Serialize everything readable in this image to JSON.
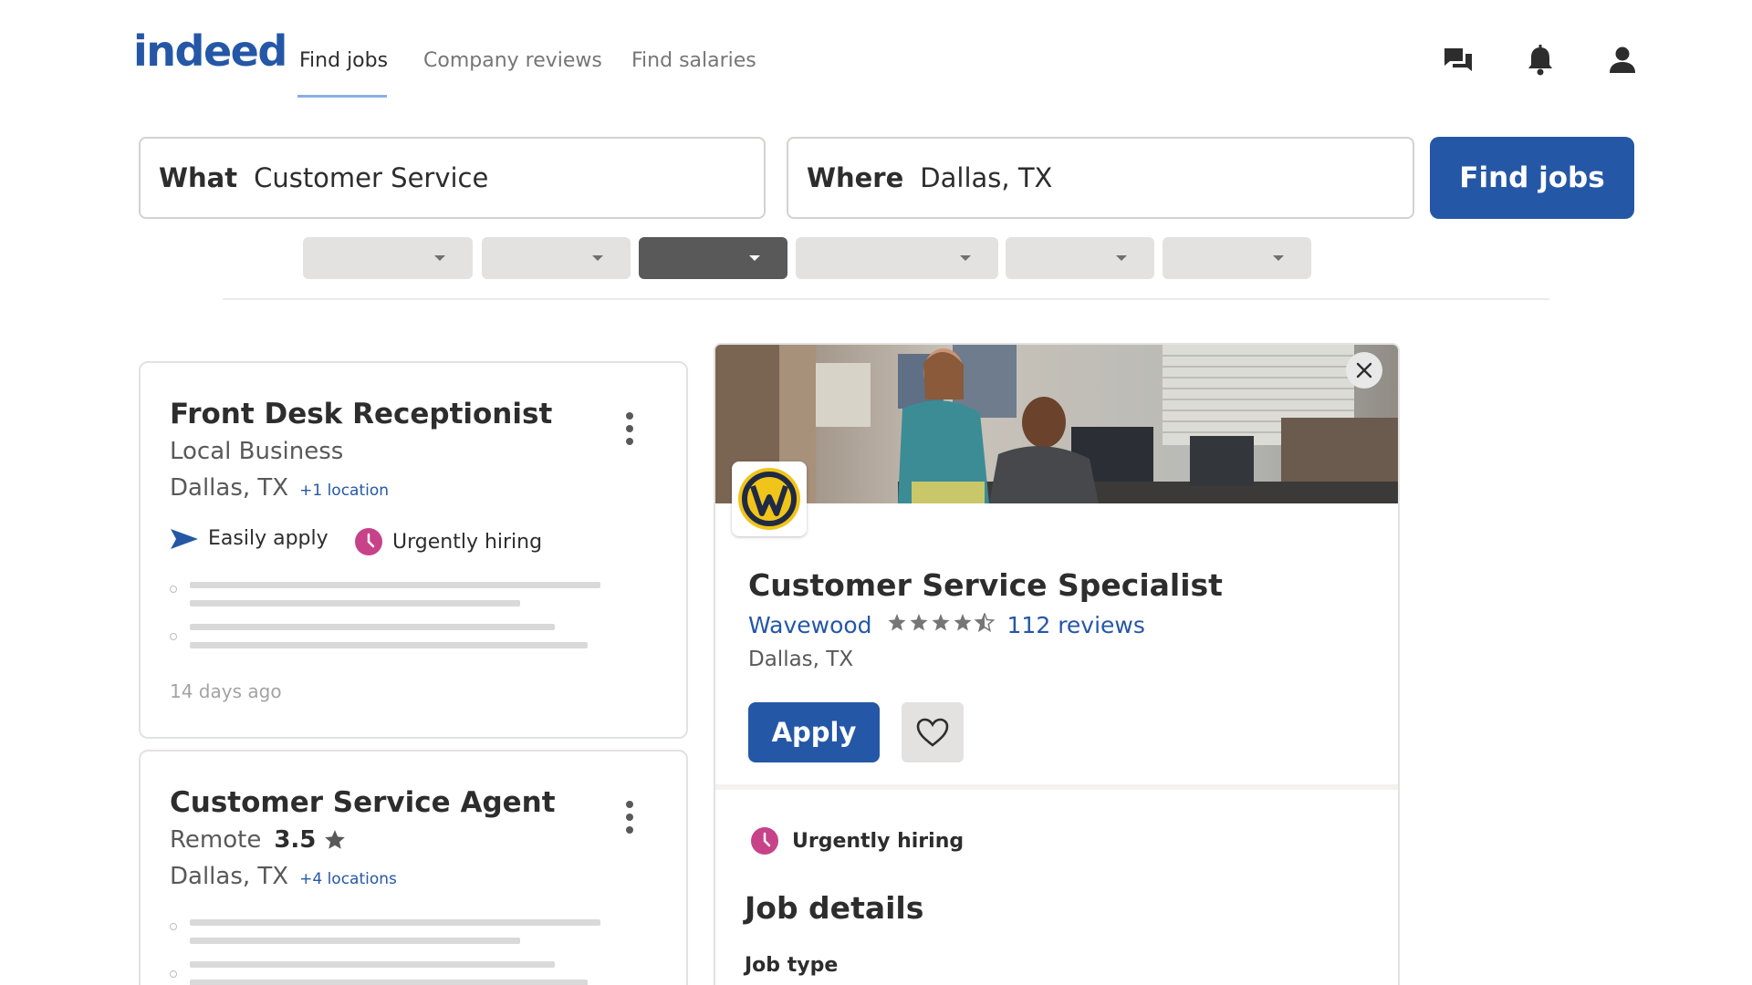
{
  "header": {
    "logo_text": "indeed",
    "nav": [
      {
        "label": "Find jobs",
        "active": true
      },
      {
        "label": "Company reviews",
        "active": false
      },
      {
        "label": "Find salaries",
        "active": false
      }
    ],
    "icons": [
      "messages-icon",
      "bell-icon",
      "profile-icon"
    ]
  },
  "search": {
    "what_label": "What",
    "what_value": "Customer Service",
    "where_label": "Where",
    "where_value": "Dallas, TX",
    "button_label": "Find jobs"
  },
  "jobs": [
    {
      "title": "Front Desk Receptionist",
      "company": "Local Business",
      "location": "Dallas, TX",
      "extra_locations": "+1 location",
      "tags": [
        "Easily apply",
        "Urgently hiring"
      ],
      "posted": "14 days ago"
    },
    {
      "title": "Customer Service Agent",
      "company": "Remote",
      "rating": "3.5",
      "location": "Dallas, TX",
      "extra_locations": "+4 locations"
    }
  ],
  "detail": {
    "title": "Customer Service Specialist",
    "company": "Wavewood",
    "rating_stars": 4.5,
    "reviews": "112 reviews",
    "location": "Dallas, TX",
    "apply_label": "Apply",
    "urgent_label": "Urgently hiring",
    "section_title": "Job details",
    "subsection_title": "Job type"
  },
  "colors": {
    "brand_blue": "#2557a7",
    "urgent_pink": "#c74289",
    "pill_gray": "#e4e2e0",
    "pill_active": "#595959"
  }
}
